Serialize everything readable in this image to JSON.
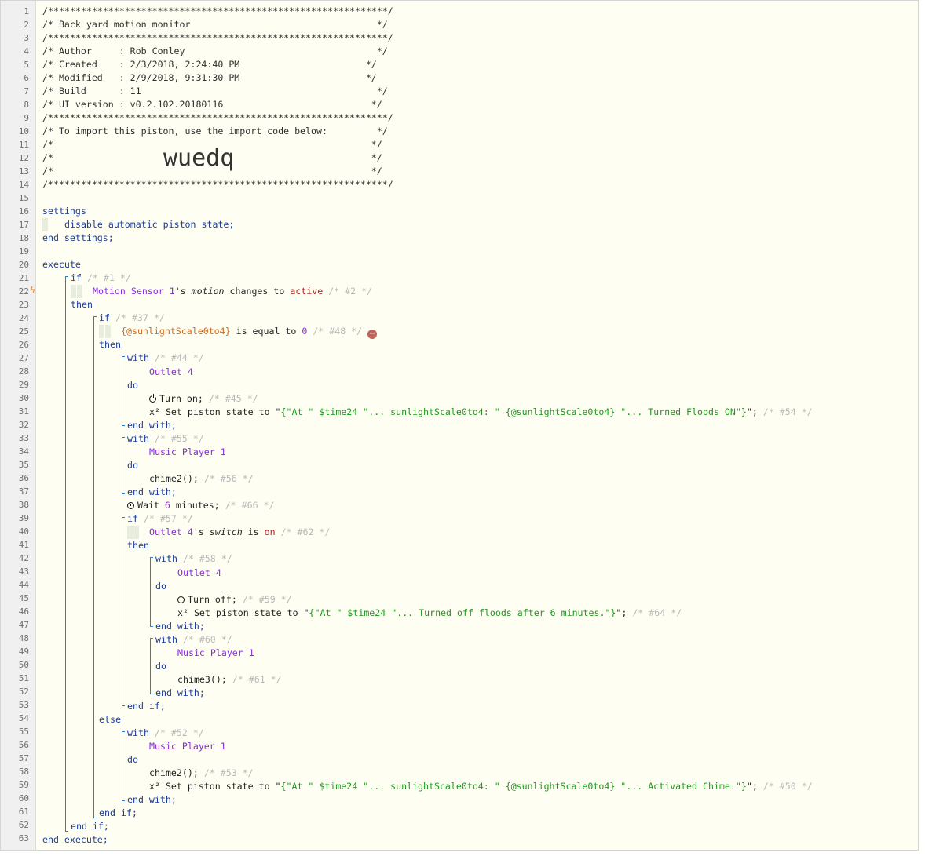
{
  "line_count": 63,
  "header": {
    "border": "/**************************************************************/",
    "title": "/* Back yard motion monitor                                  */",
    "author": "/* Author     : Rob Conley                                   */",
    "created": "/* Created    : 2/3/2018, 2:24:40 PM                       */",
    "modified": "/* Modified   : 2/9/2018, 9:31:30 PM                       */",
    "build": "/* Build      : 11                                           */",
    "ui_version": "/* UI version : v0.2.102.20180116                           */",
    "import_note": "/* To import this piston, use the import code below:         */",
    "blank": "/*                                                          */",
    "import_code": "wuedq"
  },
  "kw": {
    "settings": "settings",
    "end_settings": "end settings;",
    "execute": "execute",
    "end_execute": "end execute;",
    "if": "if",
    "then": "then",
    "else": "else",
    "end_if": "end if;",
    "with": "with",
    "do": "do",
    "end_with": "end with;"
  },
  "settings": {
    "line": "disable automatic piston state;"
  },
  "c": {
    "n1": "/* #1 */",
    "n2": "/* #2 */",
    "n37": "/* #37 */",
    "n48": "/* #48 */",
    "n44": "/* #44 */",
    "n45": "/* #45 */",
    "n54": "/* #54 */",
    "n55": "/* #55 */",
    "n56": "/* #56 */",
    "n66": "/* #66 */",
    "n57": "/* #57 */",
    "n62": "/* #62 */",
    "n58": "/* #58 */",
    "n59": "/* #59 */",
    "n64": "/* #64 */",
    "n60": "/* #60 */",
    "n61": "/* #61 */",
    "n52": "/* #52 */",
    "n53": "/* #53 */",
    "n50": "/* #50 */"
  },
  "l22": {
    "device": "Motion Sensor 1",
    "poss": "'s ",
    "attr": "motion",
    "op": " changes to ",
    "val": "active"
  },
  "l25": {
    "var": "{@sunlightScale0to4}",
    "op": " is equal to ",
    "val": "0"
  },
  "dev": {
    "outlet4": "Outlet 4",
    "music1": "Music Player 1"
  },
  "l30": {
    "text": "Turn on;"
  },
  "l31": {
    "pre": "x² Set piston state to \"",
    "str": "{\"At \" $time24 \"... sunlightScale0to4: \" {@sunlightScale0to4} \"... Turned Floods ON\"}",
    "post": "\";"
  },
  "l36": {
    "text": "chime2();"
  },
  "l38": {
    "pre": "Wait ",
    "num": "6",
    "post": " minutes;"
  },
  "l40": {
    "device": "Outlet 4",
    "poss": "'s ",
    "attr": "switch",
    "op": " is ",
    "val": "on"
  },
  "l45": {
    "text": "Turn off;"
  },
  "l46": {
    "pre": "x² Set piston state to \"",
    "str": "{\"At \" $time24 \"... Turned off floods after 6 minutes.\"}",
    "post": "\";"
  },
  "l51": {
    "text": "chime3();"
  },
  "l58": {
    "text": "chime2();"
  },
  "l59": {
    "pre": "x² Set piston state to \"",
    "str": "{\"At \" $time24 \"... sunlightScale0to4: \" {@sunlightScale0to4} \"... Activated Chime.\"}",
    "post": "\";"
  },
  "colors": {
    "keyword": "#1a3a9c",
    "device": "#8a2be2",
    "string": "#1e9a1e",
    "variable": "#d2691e",
    "bar": "#2d7bd2",
    "bolt": "#ff7a00"
  }
}
